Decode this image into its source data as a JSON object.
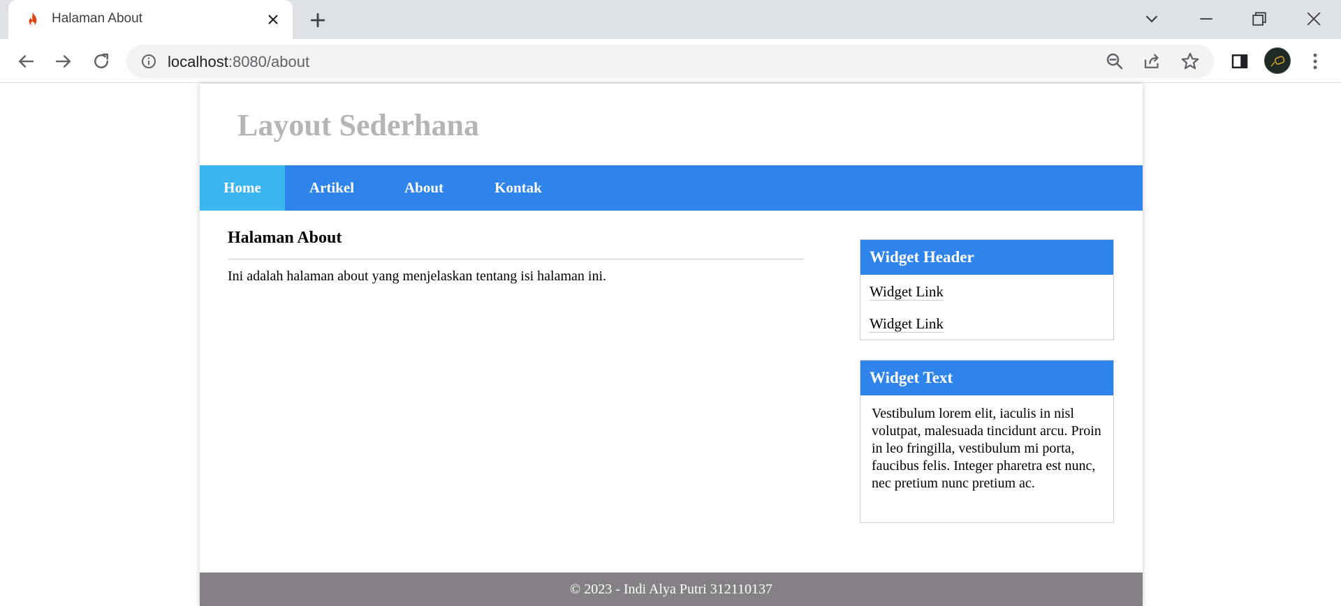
{
  "browser": {
    "tab_title": "Halaman About",
    "url_host": "localhost",
    "url_path": ":8080/about"
  },
  "site": {
    "title": "Layout Sederhana",
    "nav": [
      {
        "label": "Home",
        "active": true
      },
      {
        "label": "Artikel",
        "active": false
      },
      {
        "label": "About",
        "active": false
      },
      {
        "label": "Kontak",
        "active": false
      }
    ]
  },
  "article": {
    "title": "Halaman About",
    "text": "Ini adalah halaman about yang menjelaskan tentang isi halaman ini."
  },
  "widgets": {
    "links_widget": {
      "header": "Widget Header",
      "links": [
        "Widget Link",
        "Widget Link"
      ]
    },
    "text_widget": {
      "header": "Widget Text",
      "text": "Vestibulum lorem elit, iaculis in nisl volutpat, malesuada tincidunt arcu. Proin in leo fringilla, vestibulum mi porta, faucibus felis. Integer pharetra est nunc, nec pretium nunc pretium ac."
    }
  },
  "footer": {
    "text": "© 2023 - Indi Alya Putri 312110137"
  },
  "colors": {
    "nav_bg": "#2e84ea",
    "nav_active_bg": "#3bb5f0",
    "widget_header_bg": "#2e84ea",
    "footer_bg": "#857f86",
    "site_title": "#b5b5b5"
  }
}
